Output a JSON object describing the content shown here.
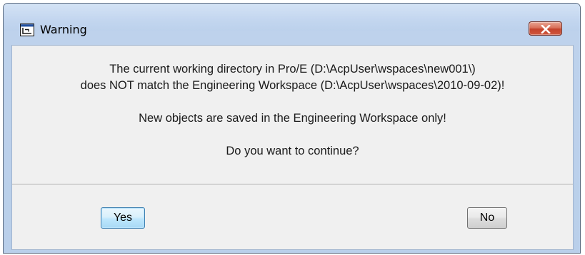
{
  "window": {
    "title": "Warning",
    "icon": "app-window-icon",
    "close_icon": "close-icon"
  },
  "message": {
    "line1": "The current working directory in Pro/E (D:\\AcpUser\\wspaces\\new001\\)",
    "line2": "does NOT match the Engineering Workspace (D:\\AcpUser\\wspaces\\2010-09-02)!",
    "line3": "New objects are saved in the Engineering Workspace only!",
    "line4": "Do you want to continue?"
  },
  "buttons": {
    "yes_label": "Yes",
    "no_label": "No"
  },
  "colors": {
    "title_bar": "#c3d6ef",
    "close_button": "#c4432c",
    "client_background": "#f0f0f0",
    "default_button_accent": "#3c7fb1"
  }
}
